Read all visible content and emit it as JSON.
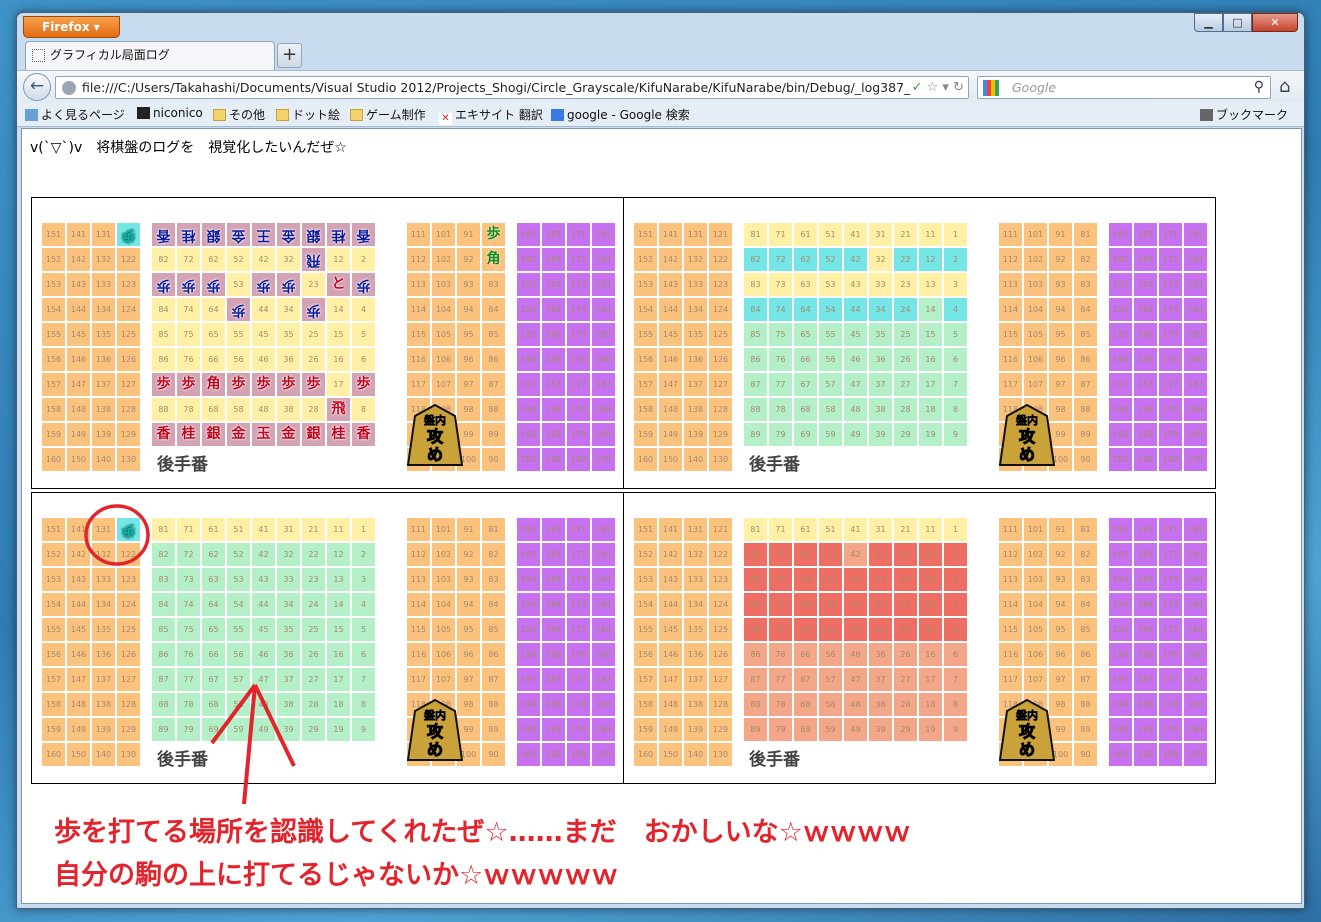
{
  "browser": {
    "menu_button": "Firefox",
    "tab_title": "グラフィカル局面ログ",
    "new_tab": "+",
    "url": "file:///C:/Users/Takahashi/Documents/Visual Studio 2012/Projects_Shogi/Circle_Grayscale/KifuNarabe/KifuNarabe/bin/Debug/_log387_",
    "search_placeholder": "Google",
    "bookmarks": [
      {
        "label": "よく見るページ",
        "icon": "page-icon"
      },
      {
        "label": "niconico",
        "icon": "tv-icon"
      },
      {
        "label": "その他",
        "icon": "folder-icon"
      },
      {
        "label": "ドット絵",
        "icon": "folder-icon"
      },
      {
        "label": "ゲーム制作",
        "icon": "folder-icon"
      },
      {
        "label": "エキサイト 翻訳",
        "icon": "excite-icon"
      },
      {
        "label": "google - Google 検索",
        "icon": "google-icon"
      }
    ],
    "bookmarks_menu": "ブックマーク"
  },
  "page": {
    "headline": "v(`▽`)v　将棋盤のログを　視覚化したいんだぜ☆",
    "turn_label": "後手番",
    "seme_label_top": "盤内",
    "seme_label_main": "攻め",
    "annotation_line1": "歩を打てる場所を認識してくれたぜ☆……まだ　おかしいな☆ｗｗｗｗ",
    "annotation_line2": "自分の駒の上に打てるじゃないか☆ｗｗｗｗｗ"
  },
  "colors": {
    "komadai_left": "#fbc27d",
    "board_yellow": "#fff0a6",
    "komadai_purple": "#c770f0",
    "highlight_cyan": "#74e6e6",
    "highlight_green": "#b3f0c8",
    "highlight_red": "#ef6e63",
    "highlight_salmon": "#f4a688",
    "piece_bg": "#d3a3b4",
    "annotation": "#e2242c"
  },
  "pieces": {
    "board1": [
      {
        "pos": "91",
        "t": "香",
        "s": "g"
      },
      {
        "pos": "81",
        "t": "桂",
        "s": "g"
      },
      {
        "pos": "71",
        "t": "銀",
        "s": "g"
      },
      {
        "pos": "61",
        "t": "金",
        "s": "g"
      },
      {
        "pos": "51",
        "t": "王",
        "s": "g"
      },
      {
        "pos": "41",
        "t": "金",
        "s": "g"
      },
      {
        "pos": "31",
        "t": "銀",
        "s": "g"
      },
      {
        "pos": "21",
        "t": "桂",
        "s": "g"
      },
      {
        "pos": "11",
        "t": "香",
        "s": "g"
      },
      {
        "pos": "32",
        "t": "飛",
        "s": "g"
      },
      {
        "pos": "93",
        "t": "歩",
        "s": "g"
      },
      {
        "pos": "83",
        "t": "歩",
        "s": "g"
      },
      {
        "pos": "73",
        "t": "歩",
        "s": "g"
      },
      {
        "pos": "53",
        "t": "歩",
        "s": "g"
      },
      {
        "pos": "43",
        "t": "歩",
        "s": "g"
      },
      {
        "pos": "23",
        "t": "と",
        "s": "s"
      },
      {
        "pos": "13",
        "t": "歩",
        "s": "g"
      },
      {
        "pos": "64",
        "t": "歩",
        "s": "g"
      },
      {
        "pos": "34",
        "t": "歩",
        "s": "g"
      },
      {
        "pos": "97",
        "t": "歩",
        "s": "s"
      },
      {
        "pos": "87",
        "t": "歩",
        "s": "s"
      },
      {
        "pos": "77",
        "t": "角",
        "s": "s"
      },
      {
        "pos": "67",
        "t": "歩",
        "s": "s"
      },
      {
        "pos": "57",
        "t": "歩",
        "s": "s"
      },
      {
        "pos": "47",
        "t": "歩",
        "s": "s"
      },
      {
        "pos": "37",
        "t": "歩",
        "s": "s"
      },
      {
        "pos": "17",
        "t": "歩",
        "s": "s"
      },
      {
        "pos": "28",
        "t": "飛",
        "s": "s"
      },
      {
        "pos": "99",
        "t": "香",
        "s": "s"
      },
      {
        "pos": "89",
        "t": "桂",
        "s": "s"
      },
      {
        "pos": "79",
        "t": "銀",
        "s": "s"
      },
      {
        "pos": "69",
        "t": "金",
        "s": "s"
      },
      {
        "pos": "59",
        "t": "玉",
        "s": "s"
      },
      {
        "pos": "49",
        "t": "金",
        "s": "s"
      },
      {
        "pos": "39",
        "t": "銀",
        "s": "s"
      },
      {
        "pos": "29",
        "t": "桂",
        "s": "s"
      },
      {
        "pos": "19",
        "t": "香",
        "s": "s"
      }
    ],
    "board1_komadai": [
      {
        "cell": "r121",
        "t": "歩",
        "s": "gl"
      },
      {
        "cell": "r81",
        "t": "歩",
        "s": "gs"
      },
      {
        "cell": "r82",
        "t": "角",
        "s": "gs"
      }
    ],
    "board3_komadai": [
      {
        "cell": "r121",
        "t": "歩",
        "s": "gl"
      }
    ]
  }
}
